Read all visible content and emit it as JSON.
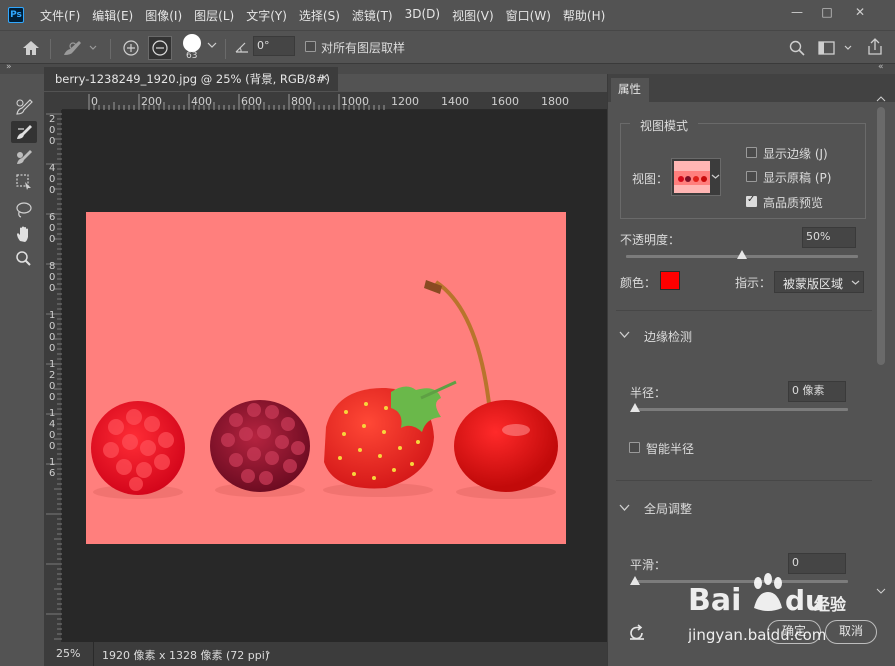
{
  "app": {
    "logo_text": "Ps"
  },
  "menu": [
    "文件(F)",
    "编辑(E)",
    "图像(I)",
    "图层(L)",
    "文字(Y)",
    "选择(S)",
    "滤镜(T)",
    "3D(D)",
    "视图(V)",
    "窗口(W)",
    "帮助(H)"
  ],
  "window_controls": {
    "minimize": "—",
    "maximize": "□",
    "close": "✕"
  },
  "options": {
    "brush_size": "63",
    "angle_value": "0°",
    "sample_all_layers_label": "对所有图层取样",
    "sample_all_layers_checked": false
  },
  "document": {
    "tab_title": "berry-1238249_1920.jpg @ 25% (背景, RGB/8#) *",
    "close_glyph": "✕",
    "ruler_h": [
      "0",
      "200",
      "400",
      "600",
      "800",
      "1000",
      "1200",
      "1400",
      "1600",
      "1800"
    ],
    "ruler_v": [
      "2",
      "0",
      "0",
      "4",
      "0",
      "0",
      "6",
      "0",
      "0",
      "8",
      "0",
      "0",
      "1",
      "0",
      "0",
      "0",
      "1",
      "2",
      "0",
      "0",
      "1",
      "4",
      "0",
      "0",
      "1",
      "6"
    ],
    "overlay_color": "#ff7f7d"
  },
  "status": {
    "zoom": "25%",
    "info": "1920 像素 x 1328 像素 (72 ppi)",
    "arrow": "›"
  },
  "properties": {
    "tab_label": "属性",
    "view_mode": {
      "group_label": "视图模式",
      "view_label": "视图：",
      "show_edge_label": "显示边缘 (J)",
      "show_edge_checked": false,
      "show_original_label": "显示原稿 (P)",
      "show_original_checked": false,
      "hq_preview_label": "高品质预览",
      "hq_preview_checked": true
    },
    "opacity": {
      "label": "不透明度：",
      "value": "50%",
      "level": 0.5
    },
    "color_label": "颜色：",
    "color_swatch": "#ff0000",
    "indicate_label": "指示：",
    "indicate_value": "被蒙版区域",
    "edge_detection": {
      "header": "边缘检测",
      "radius_label": "半径：",
      "radius_value": "0 像素",
      "radius_level": 0,
      "smart_radius_label": "智能半径",
      "smart_radius_checked": false
    },
    "global_refinements": {
      "header": "全局调整",
      "smooth_label": "平滑：",
      "smooth_value": "0",
      "smooth_level": 0
    },
    "confirm_button": "确定",
    "cancel_button": "取消"
  },
  "watermark": {
    "text": "Bai du 经验",
    "url": "jingyan.baidu.com"
  }
}
